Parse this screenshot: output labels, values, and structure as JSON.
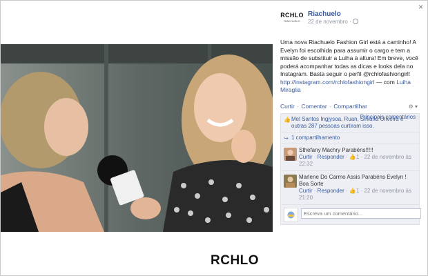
{
  "window": {
    "close_glyph": "×"
  },
  "post": {
    "page_name": "Riachuelo",
    "logo_text": "RCHLO",
    "logo_subtext": "RIACHUELO",
    "date": "22 de novembro ·",
    "text_main": "Uma nova Riachuelo Fashion Girl está a caminho! A Evelyn foi escolhida para assumir o cargo e tem a missão de substituir a Luiha à altura! Em breve, você poderá acompanhar todas as dicas e looks dela no Instagram. Basta seguir o perfil @rchlofashiongirl!",
    "link_text": "http://instagram.com/rchlofashiongirl",
    "with_text": "— com",
    "tagged": "Luiha Miraglia",
    "photo_caption": "RCHLO"
  },
  "actions": {
    "like": "Curtir",
    "comment": "Comentar",
    "share": "Compartilhar",
    "separator": "·"
  },
  "ufi": {
    "likes_names": "Mel Santos Ingjysoa, Ruan, Silvana Oliveira e outras 287 pessoas curtiram isso.",
    "top_comments": "Principais comentários ·",
    "shares": "1 compartilhamento",
    "comments": [
      {
        "author": "Sthefany Machry",
        "text": "Parabéns!!!!!",
        "like": "Curtir",
        "reply": "Responder",
        "likes_count": "1",
        "time": "22 de novembro às 22:32"
      },
      {
        "author": "Marlene Do Carmo Assis",
        "text": "Parabéns Evelyn ! Boa Sorte",
        "like": "Curtir",
        "reply": "Responder",
        "likes_count": "1",
        "time": "22 de novembro às 21:20"
      }
    ],
    "compose_placeholder": "Escreva um comentário..."
  },
  "colors": {
    "link": "#3b5998",
    "panel_bg": "#edeff4",
    "muted": "#9197a3"
  },
  "icons": [
    "close-icon",
    "globe-icon",
    "like-thumb-icon",
    "share-icon",
    "options-icon"
  ]
}
